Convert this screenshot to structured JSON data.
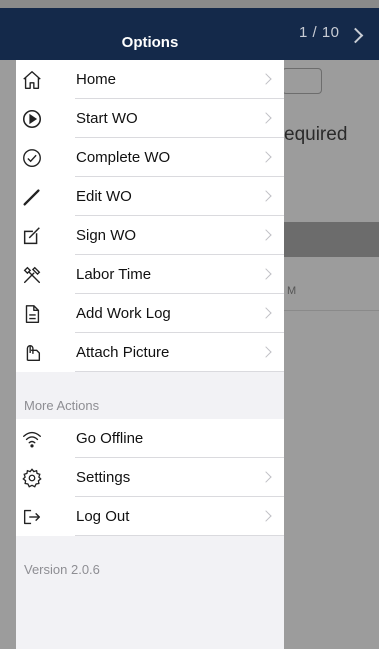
{
  "background": {
    "page_indicator": "1 / 10",
    "required_text": "equired",
    "time_fragment": "M"
  },
  "drawer": {
    "title": "Options",
    "menu": [
      {
        "label": "Home",
        "icon": "home-icon",
        "chevron": true
      },
      {
        "label": "Start WO",
        "icon": "play-circle-icon",
        "chevron": true
      },
      {
        "label": "Complete WO",
        "icon": "check-circle-icon",
        "chevron": true
      },
      {
        "label": "Edit WO",
        "icon": "pencil-icon",
        "chevron": true
      },
      {
        "label": "Sign WO",
        "icon": "sign-icon",
        "chevron": true
      },
      {
        "label": "Labor Time",
        "icon": "tools-icon",
        "chevron": true
      },
      {
        "label": "Add Work Log",
        "icon": "document-icon",
        "chevron": true
      },
      {
        "label": "Attach Picture",
        "icon": "paperclip-icon",
        "chevron": true
      }
    ],
    "more_actions_label": "More Actions",
    "more_menu": [
      {
        "label": "Go Offline",
        "icon": "wifi-icon",
        "chevron": false
      },
      {
        "label": "Settings",
        "icon": "gear-icon",
        "chevron": true
      },
      {
        "label": "Log Out",
        "icon": "logout-icon",
        "chevron": true
      }
    ],
    "version": "Version 2.0.6"
  }
}
